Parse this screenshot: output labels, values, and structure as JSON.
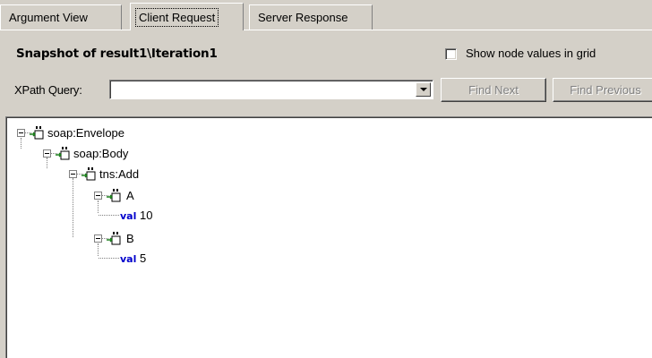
{
  "tabs": [
    {
      "label": "Argument View"
    },
    {
      "label": "Client Request"
    },
    {
      "label": "Server Response"
    }
  ],
  "header": {
    "snapshot_title": "Snapshot of result1\\Iteration1",
    "show_node_values_label": "Show node values in grid",
    "show_node_values_checked": false
  },
  "xpath": {
    "label": "XPath Query:",
    "value": "",
    "find_next_label": "Find Next",
    "find_previous_label": "Find Previous"
  },
  "tree": {
    "nodes": [
      {
        "label": "soap:Envelope"
      },
      {
        "label": "soap:Body"
      },
      {
        "label": "tns:Add"
      },
      {
        "label": "A"
      },
      {
        "keyword": "val",
        "value": "10"
      },
      {
        "label": "B"
      },
      {
        "keyword": "val",
        "value": "5"
      }
    ]
  },
  "colors": {
    "window_bg": "#d4d0c8",
    "keyword": "#0000cc",
    "disabled_text": "#808080"
  }
}
